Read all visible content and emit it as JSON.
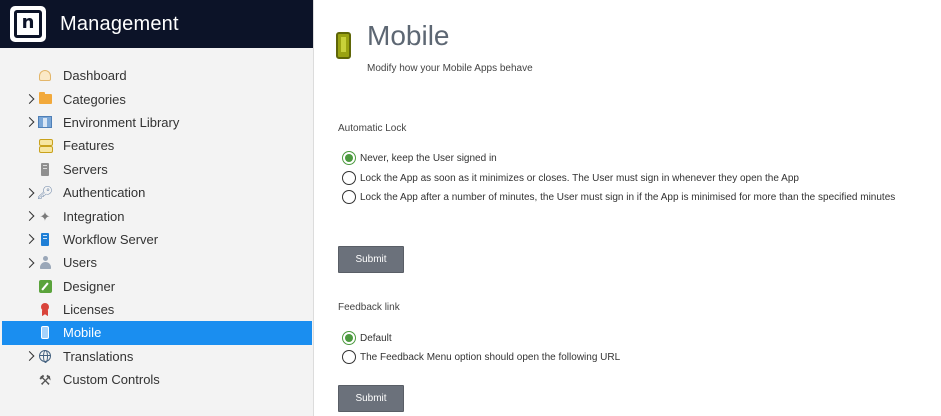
{
  "app": {
    "title": "Management",
    "logo_text": "n"
  },
  "sidebar": {
    "items": [
      {
        "label": "Dashboard",
        "icon": "dashboard-icon",
        "expandable": false,
        "active": false
      },
      {
        "label": "Categories",
        "icon": "folder-icon",
        "expandable": true,
        "active": false
      },
      {
        "label": "Environment Library",
        "icon": "environment-library-icon",
        "expandable": true,
        "active": false
      },
      {
        "label": "Features",
        "icon": "features-icon",
        "expandable": false,
        "active": false
      },
      {
        "label": "Servers",
        "icon": "server-icon",
        "expandable": false,
        "active": false
      },
      {
        "label": "Authentication",
        "icon": "key-icon",
        "expandable": true,
        "active": false
      },
      {
        "label": "Integration",
        "icon": "puzzle-icon",
        "expandable": true,
        "active": false
      },
      {
        "label": "Workflow Server",
        "icon": "workflow-server-icon",
        "expandable": true,
        "active": false
      },
      {
        "label": "Users",
        "icon": "user-icon",
        "expandable": true,
        "active": false
      },
      {
        "label": "Designer",
        "icon": "designer-icon",
        "expandable": false,
        "active": false
      },
      {
        "label": "Licenses",
        "icon": "license-ribbon-icon",
        "expandable": false,
        "active": false
      },
      {
        "label": "Mobile",
        "icon": "mobile-phone-icon",
        "expandable": false,
        "active": true
      },
      {
        "label": "Translations",
        "icon": "globe-icon",
        "expandable": true,
        "active": false
      },
      {
        "label": "Custom Controls",
        "icon": "tools-icon",
        "expandable": false,
        "active": false
      }
    ]
  },
  "page": {
    "title": "Mobile",
    "subtitle": "Modify how your Mobile Apps behave",
    "icon": "mobile-phone-icon"
  },
  "automatic_lock": {
    "label": "Automatic Lock",
    "options": [
      {
        "label": "Never, keep the User signed in",
        "checked": true
      },
      {
        "label": "Lock the App as soon as it minimizes or closes. The User must sign in whenever they open the App",
        "checked": false
      },
      {
        "label": "Lock the App after a number of minutes, the User must sign in if the App is minimised for more than the specified minutes",
        "checked": false
      }
    ],
    "submit_label": "Submit"
  },
  "feedback_link": {
    "label": "Feedback link",
    "options": [
      {
        "label": "Default",
        "checked": true
      },
      {
        "label": "The Feedback Menu option should open the following URL",
        "checked": false
      }
    ],
    "submit_label": "Submit"
  },
  "colors": {
    "brand_bar": "#0c1328",
    "active_nav": "#1a8ef0",
    "radio_checked": "#4c9a3f",
    "button": "#6b717b"
  }
}
